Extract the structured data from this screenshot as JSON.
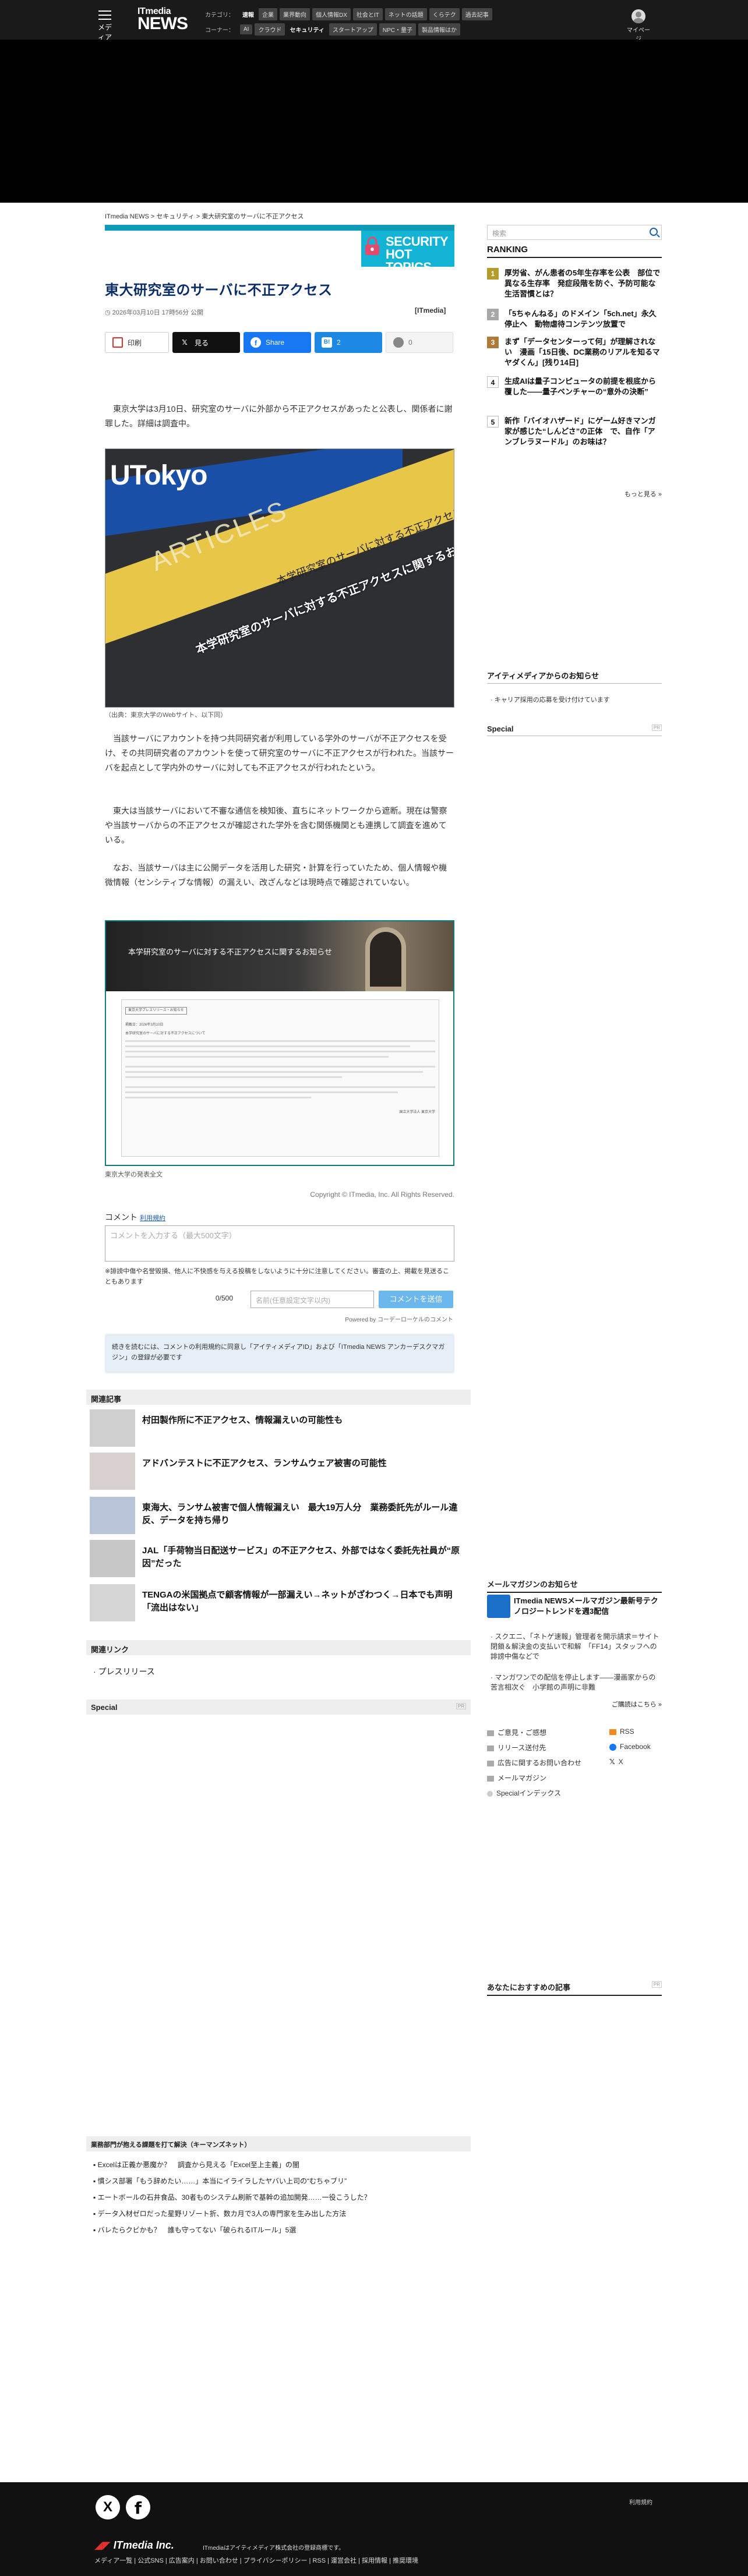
{
  "header": {
    "menu_label": "メディア",
    "logo_top": "ITmedia",
    "logo_bottom": "NEWS",
    "category_label": "カテゴリ：",
    "categories": [
      "速報",
      "企業",
      "業界動向",
      "個人情報DX",
      "社会とIT",
      "ネットの話題",
      "くらテク",
      "過去記事"
    ],
    "corner_label": "コーナー：",
    "corners": [
      "AI",
      "クラウド",
      "セキュリティ",
      "スタートアップ",
      "NPC・量子",
      "製品情報はか"
    ],
    "mypage_label": "マイページ"
  },
  "breadcrumb": "ITmedia NEWS > セキュリティ > 東大研究室のサーバに不正アクセス",
  "banner": {
    "line1": "SECURITY",
    "line2": "HOT TOPICS"
  },
  "article": {
    "title": "東大研究室のサーバに不正アクセス",
    "date": "2026年03月10日 17時56分 公開",
    "source": "[ITmedia]",
    "share": {
      "print": "印刷",
      "x": "見る",
      "facebook": "Share",
      "hatena_count": "2",
      "comment_count": "0"
    },
    "paragraphs": [
      "東京大学は3月10日、研究室のサーバに外部から不正アクセスがあったと公表し、関係者に謝罪した。詳細は調査中。",
      "当該サーバにアカウントを持つ共同研究者が利用している学外のサーバが不正アクセスを受け、その共同研究者のアカウントを使って研究室のサーバに不正アクセスが行われた。当該サーバを起点として学内外のサーバに対しても不正アクセスが行われたという。",
      "東大は当該サーバにおいて不審な通信を検知後、直ちにネットワークから遮断。現在は警察や当該サーバからの不正アクセスが確認された学外を含む関係機関とも連携して調査を進めている。",
      "なお、当該サーバは主に公開データを活用した研究・計算を行っていたため、個人情報や機微情報（センシティブな情報）の漏えい、改ざんなどは現時点で確認されていない。"
    ],
    "image1": {
      "brand": "UTokyo",
      "english": "ARTICLES",
      "jp_main": "本学研究室のサーバに対する不正アクセスに関するお知らせ",
      "jp_sub": "本学研究室のサーバに対する不正アクセスに関するお",
      "caption": "（出典：東京大学のWebサイト、以下同）"
    },
    "image2": {
      "header_title": "本学研究室のサーバに対する不正アクセスに関するお知らせ",
      "doc_tag": "東京大学プレスリリース・お知らせ",
      "doc_date": "掲載日：2026年3月10日",
      "doc_body": "本学研究室のサーバに対する不正アクセスについて",
      "doc_sign": "国立大学法人 東京大学",
      "caption": "東京大学の発表全文"
    },
    "copyright": "Copyright © ITmedia, Inc. All Rights Reserved."
  },
  "comments": {
    "heading": "コメント",
    "terms_link": "利用規約",
    "textarea_placeholder": "コメントを入力する（最大500文字）",
    "note": "※誹謗中傷や名誉毀損、他人に不快感を与える投稿をしないように十分に注意してください。審査の上、掲載を見送ることもあります",
    "counter": "0/500",
    "name_placeholder": "名前(任意設定文字以内)",
    "submit_label": "コメントを送信",
    "powered": "Powered by コーデーローケルのコメント",
    "login_note_a": "続きを読むには、コメントの利用規約に同意し「アイティメディアID」および「ITmedia NEWS アンカーデスクマガジン」の登録が必要です"
  },
  "related": {
    "heading": "関連記事",
    "items": [
      "村田製作所に不正アクセス、情報漏えいの可能性も",
      "アドバンテストに不正アクセス、ランサムウェア被害の可能性",
      "東海大、ランサム被害で個人情報漏えい　最大19万人分　業務委託先がルール違反、データを持ち帰り",
      "JAL「手荷物当日配送サービス」の不正アクセス、外部ではなく委託先社員が“原因”だった",
      "TENGAの米国拠点で顧客情報が一部漏えい→ネットがざわつく→日本でも声明「流出はない」"
    ]
  },
  "related_links": {
    "heading": "関連リンク",
    "items": [
      "プレスリリース"
    ]
  },
  "special_main": {
    "heading": "Special",
    "pr": "PR"
  },
  "tanzaku": {
    "heading": "業務部門が抱える課題を打て解決（キーマンズネット）",
    "items": [
      "Excelは正義か悪魔か？　調査から見える「Excel至上主義」の闇",
      "慣シス部署「もう辞めたい……」本当にイライラしたヤバい上司の“むちゃブリ”",
      "エートボールの石井食品、30者ものシステム刷新で基幹の追加開発……一役こうした？",
      "データ入材ゼロだった星野リゾート折、数カ月で3人の専門家を生み出した方法",
      "バレたらクビかも？　誰も守ってない「破られるITルール」5選"
    ]
  },
  "sidebar": {
    "search_placeholder": "検索",
    "ranking_heading": "RANKING",
    "ranking": [
      {
        "n": "1",
        "title": "厚労省、がん患者の5年生存率を公表　部位で異なる生存率　発症段階を防ぐ、予防可能な生活習慣とは？"
      },
      {
        "n": "2",
        "title": "「5ちゃんねる」のドメイン「5ch.net」永久停止へ　動物虐待コンテンツ放置で"
      },
      {
        "n": "3",
        "title": "まず「データセンターって何」が理解されない　漫画「15日後、DC業務のリアルを知るマヤダくん」[残り14日]"
      },
      {
        "n": "4",
        "title": "生成AIは量子コンピュータの前提を根底から覆した――量子ベンチャーの“意外の決断”"
      },
      {
        "n": "5",
        "title": "新作「バイオハザード」にゲーム好きマンガ家が感じた“しんどさ”の正体　で、自作「アンブレラヌードル」のお味は？"
      }
    ],
    "ranking_more": "もっと見る »",
    "info_heading": "アイティメディアからのお知らせ",
    "info_items": [
      "キャリア採用の応募を受け付けています"
    ],
    "special_heading": "Special",
    "special_pr": "PR",
    "mailmag_heading": "メールマガジンのお知らせ",
    "mailmag_title": "ITmedia NEWSメールマガジン最新号テクノロジートレンドを週3配信",
    "mailmag_items": [
      "スクエニ、「ネトゲ速報」管理者を開示請求＝サイト閉鎖＆解決金の支払いで和解　「FF14」スタッフへの誹謗中傷などで",
      "マンガワンでの配信を停止します――漫画家からの苦言相次ぐ　小学館の声明に非難"
    ],
    "mailmag_more": "ご購読はこちら »",
    "utility": {
      "opinion": "ご意見・ご感想",
      "rss": "RSS",
      "release": "リリース送付先",
      "facebook": "Facebook",
      "ad": "広告に関するお問い合わせ",
      "x": "X",
      "mailmag": "メールマガジン",
      "special_index": "Specialインデックス"
    },
    "recommend_heading": "あなたにおすすめの記事",
    "recommend_pr": "PR"
  },
  "footer": {
    "x_icon": "X",
    "fb_icon": "f",
    "privacy": "利用規約",
    "company": "ITmedia Inc.",
    "registered": "ITmediaはアイティメディア株式会社の登録商標です。",
    "links": "メディア一覧 | 公式SNS | 広告案内 | お問い合わせ | プライバシーポリシー | RSS | 運営会社 | 採用情報 | 推奨環境"
  },
  "colors": {
    "header_bg": "#1a1a1a",
    "title_blue": "#0b2c6a",
    "banner_cyan": "#12b3d4",
    "rank_gold": "#b39c2b",
    "rank_dark": "#2b2b2b",
    "submit_blue": "#6cb7ee"
  }
}
